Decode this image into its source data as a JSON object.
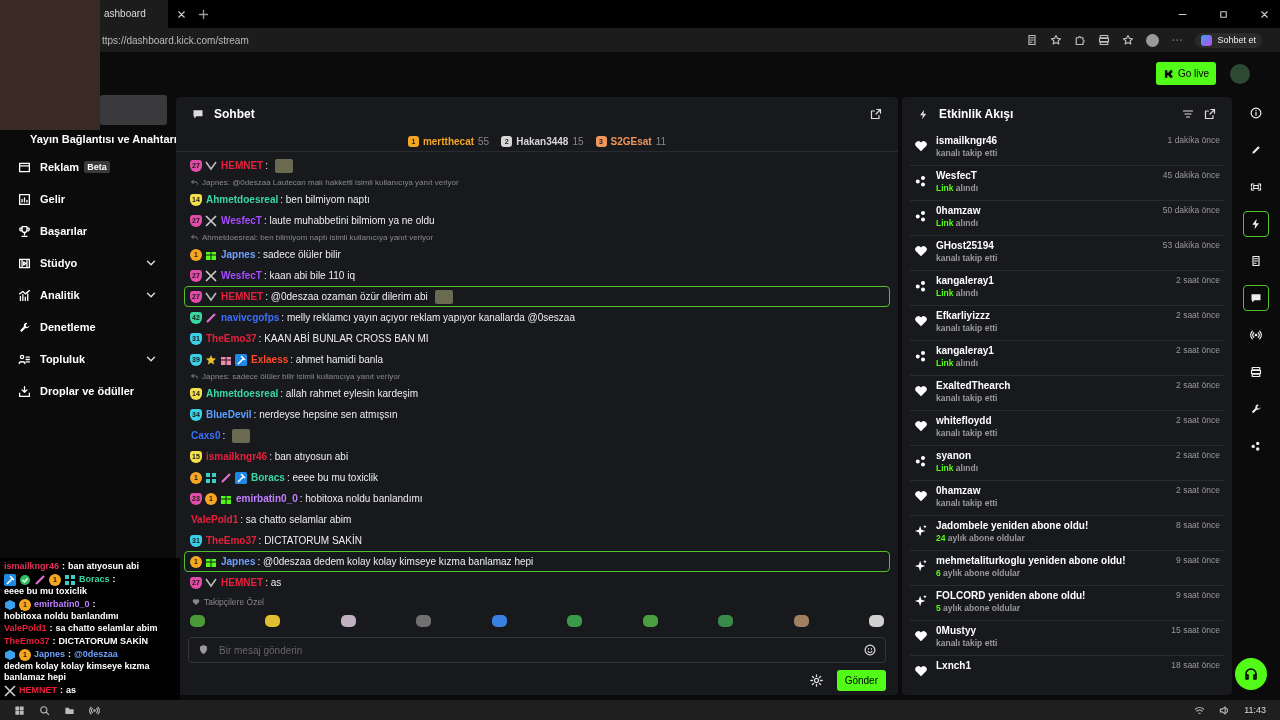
{
  "browser": {
    "tab_title": "ashboard",
    "url": "ttps://dashboard.kick.com/stream",
    "copilot_label": "Sohbet et"
  },
  "header": {
    "go_live": "Go live"
  },
  "sidebar": {
    "section_title": "Yayın Bağlantısı ve Anahtarı",
    "items": [
      {
        "kind": "link",
        "label": "Reklam",
        "badge": "Beta"
      },
      {
        "kind": "link",
        "label": "Gelir"
      },
      {
        "kind": "link",
        "label": "Başarılar"
      },
      {
        "kind": "group",
        "label": "Stüdyo",
        "expanded": false
      },
      {
        "kind": "group",
        "label": "Analitik",
        "expanded": false
      },
      {
        "kind": "link",
        "label": "Denetleme"
      },
      {
        "kind": "group",
        "label": "Topluluk",
        "expanded": false
      },
      {
        "kind": "link",
        "label": "Droplar ve ödüller"
      }
    ]
  },
  "chat": {
    "title": "Sohbet",
    "leaders": [
      {
        "rank": "1",
        "user": "mertthecat",
        "count": "55",
        "color": "#f5a623"
      },
      {
        "rank": "2",
        "user": "Hakan3448",
        "count": "15",
        "color": "#d6d6d6"
      },
      {
        "rank": "3",
        "user": "S2GEsat",
        "count": "11",
        "color": "#f0965a"
      }
    ],
    "messages": [
      {
        "kind": "message",
        "user": "HEMNET",
        "color": "#e8203c",
        "badges": [
          {
            "kind": "sub",
            "label": "27",
            "color": "#e04ca8"
          },
          {
            "kind": "chevron"
          }
        ],
        "text": ":",
        "emote": true,
        "highlighted": false
      },
      {
        "kind": "reply",
        "text": "Japnes: @0deszaa Lautecan malı hakketti isimli kullanıcıya yanıt veriyor"
      },
      {
        "kind": "message",
        "user": "Ahmetdoesreal",
        "color": "#3ad8a0",
        "badges": [
          {
            "kind": "sub",
            "label": "14",
            "color": "#f4e04a"
          }
        ],
        "text": ": ben bilmiyom naptı",
        "highlighted": false
      },
      {
        "kind": "message",
        "user": "WesfecT",
        "color": "#a64cff",
        "badges": [
          {
            "kind": "sub",
            "label": "27",
            "color": "#e04ca8"
          },
          {
            "kind": "sword"
          }
        ],
        "text": ": laute muhabbetini bilmiom ya ne oldu",
        "highlighted": false
      },
      {
        "kind": "reply",
        "text": "Ahmetdoesreal: ben bilmiyom naptı isimli kullanıcıya yanıt veriyor"
      },
      {
        "kind": "message",
        "user": "Japnes",
        "color": "#6fa0ff",
        "badges": [
          {
            "kind": "rank",
            "label": "1"
          },
          {
            "kind": "gift",
            "color": "#53fc18"
          }
        ],
        "text": ": sadece ölüler bilir",
        "highlighted": false
      },
      {
        "kind": "message",
        "user": "WesfecT",
        "color": "#a64cff",
        "badges": [
          {
            "kind": "sub",
            "label": "27",
            "color": "#e04ca8"
          },
          {
            "kind": "sword"
          }
        ],
        "text": ": kaan abi bile 110 iq",
        "highlighted": false
      },
      {
        "kind": "message",
        "user": "HEMNET",
        "color": "#e8203c",
        "badges": [
          {
            "kind": "sub",
            "label": "27",
            "color": "#e04ca8"
          },
          {
            "kind": "chevron"
          }
        ],
        "text": ": @0deszaa ozaman özür dilerim abi",
        "emote": true,
        "highlighted": true
      },
      {
        "kind": "message",
        "user": "navivcgofps",
        "color": "#3a6fff",
        "badges": [
          {
            "kind": "sub",
            "label": "42",
            "color": "#3ad8a0"
          },
          {
            "kind": "pencil"
          }
        ],
        "text": ": melly reklamcı yayın açıyor reklam yapıyor kanallarda @0seszaa",
        "highlighted": false
      },
      {
        "kind": "message",
        "user": "TheEmo37",
        "color": "#e8203c",
        "badges": [
          {
            "kind": "sub",
            "label": "31",
            "color": "#3ad0e8"
          }
        ],
        "text": ": KAAN ABİ BUNLAR CROSS BAN MI",
        "highlighted": false
      },
      {
        "kind": "message",
        "user": "Exlaess",
        "color": "#ff4a2a",
        "badges": [
          {
            "kind": "sub",
            "label": "39",
            "color": "#3ad0e8"
          },
          {
            "kind": "star"
          },
          {
            "kind": "gift",
            "color": "#f08ab0"
          },
          {
            "kind": "hammer"
          }
        ],
        "text": ": ahmet hamidi banla",
        "highlighted": false
      },
      {
        "kind": "reply",
        "text": "Japnes: sadece ölüler bilir isimli kullanıcıya yanıt veriyor"
      },
      {
        "kind": "message",
        "user": "Ahmetdoesreal",
        "color": "#3ad8a0",
        "badges": [
          {
            "kind": "sub",
            "label": "14",
            "color": "#f4e04a"
          }
        ],
        "text": ": allah rahmet eylesin kardeşim",
        "highlighted": false
      },
      {
        "kind": "message",
        "user": "BlueDevil",
        "color": "#5aa0ff",
        "badges": [
          {
            "kind": "sub",
            "label": "34",
            "color": "#3ad0e8"
          }
        ],
        "text": ": nerdeyse hepsine sen atmışsın",
        "highlighted": false
      },
      {
        "kind": "message",
        "user": "Caxs0",
        "color": "#3a6fff",
        "text": ":",
        "emote": true,
        "highlighted": false
      },
      {
        "kind": "message",
        "user": "ismailkngr46",
        "color": "#e8203c",
        "badges": [
          {
            "kind": "sub",
            "label": "15",
            "color": "#f4e04a"
          }
        ],
        "text": ": ban atıyosun abi",
        "highlighted": false
      },
      {
        "kind": "message",
        "user": "Boracs",
        "color": "#3ad8a0",
        "badges": [
          {
            "kind": "rank",
            "label": "1"
          },
          {
            "kind": "pixel"
          },
          {
            "kind": "pencil"
          },
          {
            "kind": "hammer"
          }
        ],
        "text": ": eeee bu mu toxiclik",
        "highlighted": false
      },
      {
        "kind": "message",
        "user": "emirbatin0_0",
        "color": "#c080ff",
        "badges": [
          {
            "kind": "sub",
            "label": "23",
            "color": "#e04ca8"
          },
          {
            "kind": "rank",
            "label": "1"
          },
          {
            "kind": "gift",
            "color": "#53fc18"
          }
        ],
        "text": ": hobitoxa noldu banlandımı",
        "highlighted": false
      },
      {
        "kind": "message",
        "user": "ValePold1",
        "color": "#e8203c",
        "text": ": sa chatto selamlar abim",
        "highlighted": false
      },
      {
        "kind": "message",
        "user": "TheEmo37",
        "color": "#e8203c",
        "badges": [
          {
            "kind": "sub",
            "label": "31",
            "color": "#3ad0e8"
          }
        ],
        "text": ": DICTATORUM SAKİN",
        "highlighted": false
      },
      {
        "kind": "message",
        "user": "Japnes",
        "color": "#6fa0ff",
        "badges": [
          {
            "kind": "rank",
            "label": "1"
          },
          {
            "kind": "gift",
            "color": "#53fc18"
          }
        ],
        "text": ": @0deszaa dedem kolay kolay kimseye kızma banlamaz hepi",
        "highlighted": true
      },
      {
        "kind": "message",
        "user": "HEMNET",
        "color": "#e8203c",
        "badges": [
          {
            "kind": "sub",
            "label": "27",
            "color": "#e04ca8"
          },
          {
            "kind": "chevron"
          }
        ],
        "text": ": as",
        "highlighted": false
      }
    ],
    "emote_section": "Takipçilere Özel",
    "placeholder": "Bir mesaj gönderin",
    "send": "Gönder"
  },
  "feed": {
    "title": "Etkinlik Akışı",
    "events": [
      {
        "kind": "follow",
        "title": "ismailkngr46",
        "detail": "kanalı takip etti",
        "time": "1 dakika önce"
      },
      {
        "kind": "link",
        "title": "WesfecT",
        "highlight": "Link",
        "detail": "alındı",
        "time": "45 dakika önce"
      },
      {
        "kind": "link",
        "title": "0hamzaw",
        "highlight": "Link",
        "detail": "alındı",
        "time": "50 dakika önce"
      },
      {
        "kind": "follow",
        "title": "GHost25194",
        "detail": "kanalı takip etti",
        "time": "53 dakika önce"
      },
      {
        "kind": "link",
        "title": "kangaleray1",
        "highlight": "Link",
        "detail": "alındı",
        "time": "2 saat önce"
      },
      {
        "kind": "follow",
        "title": "Efkarliyizzz",
        "detail": "kanalı takip etti",
        "time": "2 saat önce"
      },
      {
        "kind": "link",
        "title": "kangaleray1",
        "highlight": "Link",
        "detail": "alındı",
        "time": "2 saat önce"
      },
      {
        "kind": "follow",
        "title": "ExaltedThearch",
        "detail": "kanalı takip etti",
        "time": "2 saat önce"
      },
      {
        "kind": "follow",
        "title": "whitefloydd",
        "detail": "kanalı takip etti",
        "time": "2 saat önce"
      },
      {
        "kind": "link",
        "title": "syanon",
        "highlight": "Link",
        "detail": "alındı",
        "time": "2 saat önce"
      },
      {
        "kind": "follow",
        "title": "0hamzaw",
        "detail": "kanalı takip etti",
        "time": "2 saat önce"
      },
      {
        "kind": "resub",
        "title": "Jadombele yeniden abone oldu!",
        "highlight": "24",
        "detail": "aylık abone oldular",
        "time": "8 saat önce"
      },
      {
        "kind": "resub",
        "title": "mehmetaliturkoglu yeniden abone oldu!",
        "highlight": "6",
        "detail": "aylık abone oldular",
        "time": "9 saat önce"
      },
      {
        "kind": "resub",
        "title": "FOLCORD yeniden abone oldu!",
        "highlight": "5",
        "detail": "aylık abone oldular",
        "time": "9 saat önce"
      },
      {
        "kind": "follow",
        "title": "0Mustyy",
        "detail": "kanalı takip etti",
        "time": "15 saat önce"
      },
      {
        "kind": "follow",
        "title": "Lxnch1",
        "time": "18 saat önce"
      }
    ]
  },
  "rail": {
    "items": [
      {
        "active": false
      },
      {
        "active": false
      },
      {
        "active": false
      },
      {
        "active": true
      },
      {
        "active": false
      },
      {
        "active": true
      },
      {
        "active": false
      },
      {
        "active": false
      },
      {
        "active": false
      },
      {
        "active": false
      }
    ]
  },
  "overlay": {
    "lines": [
      {
        "user": "ismailkngr46",
        "color": "#e8305a",
        "sep": ":",
        "text": "ban atıyosun abi"
      },
      {
        "user": "Boracs",
        "color": "#3ad8a0",
        "badges": [
          {
            "kind": "hammer"
          },
          {
            "kind": "check"
          },
          {
            "kind": "pencil"
          },
          {
            "kind": "rank",
            "label": "1"
          },
          {
            "kind": "pixel"
          }
        ],
        "sep": ":",
        "text": "eeee bu mu toxiclik"
      },
      {
        "user": "emirbatin0_0",
        "color": "#c080ff",
        "badges": [
          {
            "kind": "cube"
          },
          {
            "kind": "rank",
            "label": "1"
          }
        ],
        "sep": ":",
        "text": "hobitoxa noldu banlandımı"
      },
      {
        "user": "ValePold1",
        "color": "#e8203c",
        "sep": ":",
        "text": "sa chatto selamlar abim"
      },
      {
        "user": "TheEmo37",
        "color": "#e8203c",
        "sep": ":",
        "text": "DICTATORUM SAKİN"
      },
      {
        "user": "Japnes",
        "color": "#6fa0ff",
        "badges": [
          {
            "kind": "cube"
          },
          {
            "kind": "rank",
            "label": "1"
          }
        ],
        "sep": ":",
        "mention": "@0deszaa",
        "text": "dedem kolay kolay kimseye kızma banlamaz hepi"
      },
      {
        "user": "HEMNET",
        "color": "#e8203c",
        "badges": [
          {
            "kind": "sword"
          }
        ],
        "sep": ":",
        "text": "as"
      }
    ]
  },
  "taskbar": {
    "time": "11:43"
  }
}
